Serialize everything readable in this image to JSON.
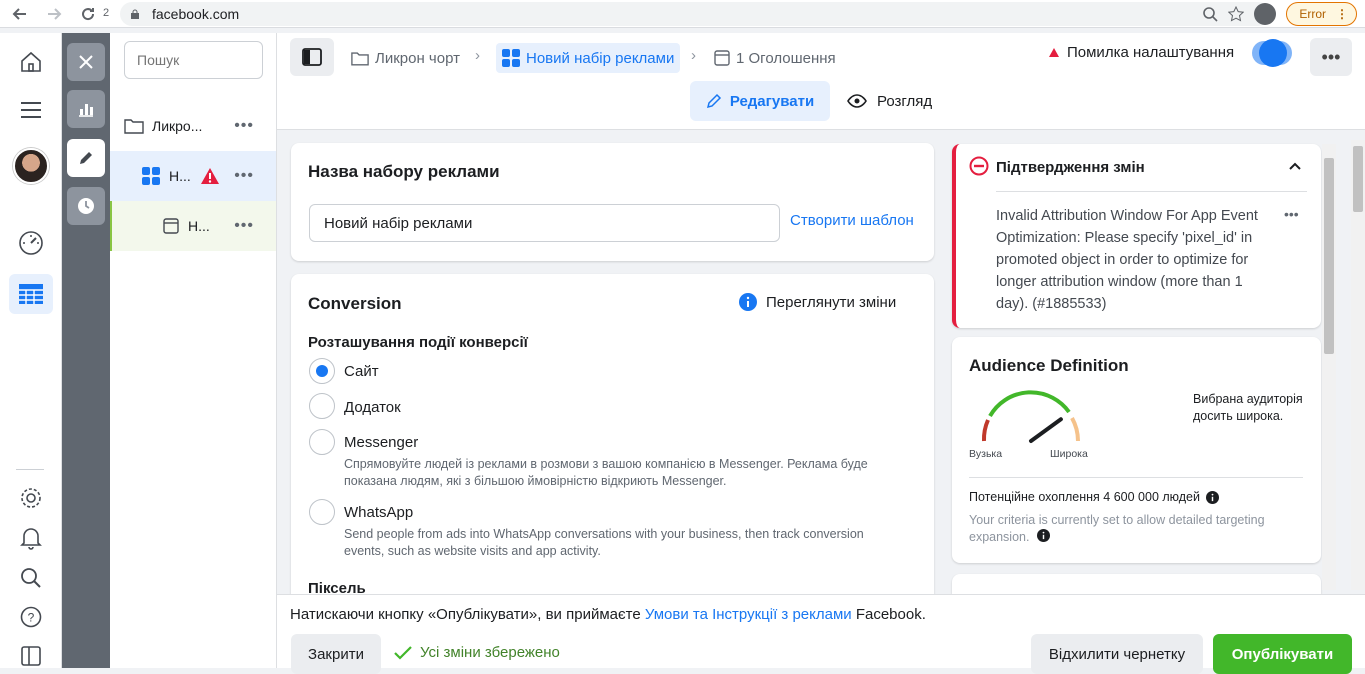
{
  "browser": {
    "tab_count": "2",
    "url": "facebook.com",
    "error_label": "Error"
  },
  "tree": {
    "search_placeholder": "Пошук",
    "campaign_label": "Ликро...",
    "adset_label": "Н...",
    "ad_label": "Н..."
  },
  "header": {
    "crumbs": [
      "Ликрон чорт",
      "Новий набір реклами",
      "1 Оголошення"
    ],
    "status_error": "Помилка налаштування",
    "tab_edit": "Редагувати",
    "tab_view": "Розгляд"
  },
  "name_card": {
    "title": "Назва набору реклами",
    "input_value": "Новий набір реклами",
    "template_link": "Створити шаблон"
  },
  "conversion_card": {
    "title": "Conversion",
    "review_link": "Переглянути зміни",
    "location_label": "Розташування події конверсії",
    "options": [
      {
        "label": "Сайт",
        "selected": true,
        "desc": ""
      },
      {
        "label": "Додаток",
        "selected": false,
        "desc": ""
      },
      {
        "label": "Messenger",
        "selected": false,
        "desc": "Спрямовуйте людей із реклами в розмови з вашою компанією в Messenger. Реклама буде показана людям, які з більшою ймовірністю відкриють Messenger."
      },
      {
        "label": "WhatsApp",
        "selected": false,
        "desc": "Send people from ads into WhatsApp conversations with your business, then track conversion events, such as website visits and app activity."
      }
    ],
    "pixel_label": "Піксель"
  },
  "error_card": {
    "title": "Підтвердження змін",
    "message": "Invalid Attribution Window For App Event Optimization: Please specify 'pixel_id' in promoted object in order to optimize for longer attribution window (more than 1 day). (#1885533)"
  },
  "audience_card": {
    "title": "Audience Definition",
    "gauge_narrow": "Вузька",
    "gauge_broad": "Широка",
    "gauge_level": 0.8,
    "verdict": "Вибрана аудиторія досить широка.",
    "reach": "Потенційне охоплення 4 600 000 людей",
    "criteria": "Your criteria is currently set to allow detailed targeting expansion."
  },
  "footer": {
    "terms_prefix": "Натискаючи кнопку «Опублікувати», ви приймаєте ",
    "terms_link": "Умови та Інструкції з реклами",
    "terms_suffix": " Facebook.",
    "close_btn": "Закрити",
    "saved_status": "Усі зміни збережено",
    "discard_btn": "Відхилити чернетку",
    "publish_btn": "Опублікувати"
  },
  "colors": {
    "accent": "#1877f2",
    "error": "#e41e3f",
    "publish": "#42b72a"
  }
}
